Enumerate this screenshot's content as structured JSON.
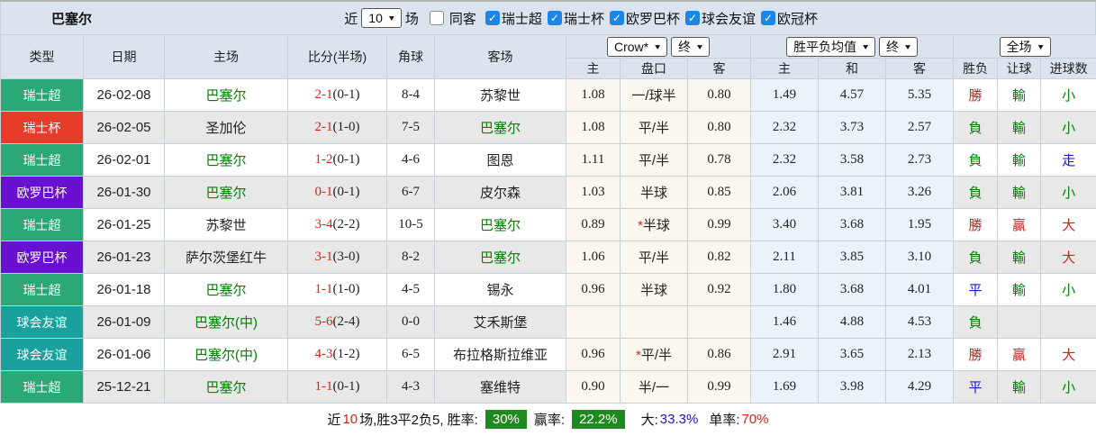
{
  "topbar": {
    "team": "巴塞尔",
    "recent_label": "近",
    "recent_value": "10",
    "matches_label": "场",
    "same_away": {
      "label": "同客",
      "checked": false
    },
    "league_filters": [
      {
        "label": "瑞士超",
        "checked": true
      },
      {
        "label": "瑞士杯",
        "checked": true
      },
      {
        "label": "欧罗巴杯",
        "checked": true
      },
      {
        "label": "球会友谊",
        "checked": true
      },
      {
        "label": "欧冠杯",
        "checked": true
      }
    ]
  },
  "controls": {
    "company": "Crow*",
    "company_time": "终",
    "europe": "胜平负均值",
    "europe_time": "终",
    "scope": "全场"
  },
  "columns": {
    "type": "类型",
    "date": "日期",
    "home": "主场",
    "score": "比分(半场)",
    "corner": "角球",
    "away": "客场",
    "ah_home": "主",
    "ah_line": "盘口",
    "ah_away": "客",
    "eu_home": "主",
    "eu_draw": "和",
    "eu_away": "客",
    "result": "胜负",
    "let_result": "让球",
    "goals": "进球数"
  },
  "colors": {
    "badge_green": "#2aa876",
    "badge_red": "#e83b28",
    "badge_purple": "#6a10d0",
    "badge_teal": "#19a29d",
    "text_green": "#008000",
    "text_red": "#d42318",
    "text_blue": "#1515cc",
    "bg_handicap": "#fbf6ee",
    "bg_europe": "#eaf2fa",
    "bg_header": "#dbe4ee",
    "bg_stripe": "#e8e8e8",
    "checkbox_blue": "#1b86e8",
    "footer_badge_green": "#1e8a1e"
  },
  "rows": [
    {
      "type": "瑞士超",
      "badge": "green",
      "date": "26-02-08",
      "home": "巴塞尔",
      "home_self": true,
      "score": "2-1",
      "half": "(0-1)",
      "corner": "8-4",
      "away": "苏黎世",
      "away_self": false,
      "ah_home": "1.08",
      "ah_star": "",
      "ah_line": "一/球半",
      "ah_away": "0.80",
      "eu_home": "1.49",
      "eu_draw": "4.57",
      "eu_away": "5.35",
      "result": "勝",
      "result_color": "darkred",
      "let": "輸",
      "let_color": "green",
      "goal": "小",
      "goal_color": "green"
    },
    {
      "type": "瑞士杯",
      "badge": "red",
      "date": "26-02-05",
      "home": "圣加伦",
      "home_self": false,
      "score": "2-1",
      "half": "(1-0)",
      "corner": "7-5",
      "away": "巴塞尔",
      "away_self": true,
      "ah_home": "1.08",
      "ah_star": "",
      "ah_line": "平/半",
      "ah_away": "0.80",
      "eu_home": "2.32",
      "eu_draw": "3.73",
      "eu_away": "2.57",
      "result": "負",
      "result_color": "green",
      "let": "輸",
      "let_color": "green",
      "goal": "小",
      "goal_color": "green"
    },
    {
      "type": "瑞士超",
      "badge": "green",
      "date": "26-02-01",
      "home": "巴塞尔",
      "home_self": true,
      "score": "1-2",
      "half": "(0-1)",
      "corner": "4-6",
      "away": "图恩",
      "away_self": false,
      "ah_home": "1.11",
      "ah_star": "",
      "ah_line": "平/半",
      "ah_away": "0.78",
      "eu_home": "2.32",
      "eu_draw": "3.58",
      "eu_away": "2.73",
      "result": "負",
      "result_color": "green",
      "let": "輸",
      "let_color": "green",
      "goal": "走",
      "goal_color": "blue"
    },
    {
      "type": "欧罗巴杯",
      "badge": "purple",
      "date": "26-01-30",
      "home": "巴塞尔",
      "home_self": true,
      "score": "0-1",
      "half": "(0-1)",
      "corner": "6-7",
      "away": "皮尔森",
      "away_self": false,
      "ah_home": "1.03",
      "ah_star": "",
      "ah_line": "半球",
      "ah_away": "0.85",
      "eu_home": "2.06",
      "eu_draw": "3.81",
      "eu_away": "3.26",
      "result": "負",
      "result_color": "green",
      "let": "輸",
      "let_color": "green",
      "goal": "小",
      "goal_color": "green"
    },
    {
      "type": "瑞士超",
      "badge": "green",
      "date": "26-01-25",
      "home": "苏黎世",
      "home_self": false,
      "score": "3-4",
      "half": "(2-2)",
      "corner": "10-5",
      "away": "巴塞尔",
      "away_self": true,
      "ah_home": "0.89",
      "ah_star": "*",
      "ah_line": "半球",
      "ah_away": "0.99",
      "eu_home": "3.40",
      "eu_draw": "3.68",
      "eu_away": "1.95",
      "result": "勝",
      "result_color": "darkred",
      "let": "贏",
      "let_color": "darkred",
      "goal": "大",
      "goal_color": "red"
    },
    {
      "type": "欧罗巴杯",
      "badge": "purple",
      "date": "26-01-23",
      "home": "萨尔茨堡红牛",
      "home_self": false,
      "score": "3-1",
      "half": "(3-0)",
      "corner": "8-2",
      "away": "巴塞尔",
      "away_self": true,
      "ah_home": "1.06",
      "ah_star": "",
      "ah_line": "平/半",
      "ah_away": "0.82",
      "eu_home": "2.11",
      "eu_draw": "3.85",
      "eu_away": "3.10",
      "result": "負",
      "result_color": "green",
      "let": "輸",
      "let_color": "green",
      "goal": "大",
      "goal_color": "red"
    },
    {
      "type": "瑞士超",
      "badge": "green",
      "date": "26-01-18",
      "home": "巴塞尔",
      "home_self": true,
      "score": "1-1",
      "half": "(1-0)",
      "corner": "4-5",
      "away": "锡永",
      "away_self": false,
      "ah_home": "0.96",
      "ah_star": "",
      "ah_line": "半球",
      "ah_away": "0.92",
      "eu_home": "1.80",
      "eu_draw": "3.68",
      "eu_away": "4.01",
      "result": "平",
      "result_color": "blue",
      "let": "輸",
      "let_color": "green",
      "goal": "小",
      "goal_color": "green"
    },
    {
      "type": "球会友谊",
      "badge": "teal",
      "date": "26-01-09",
      "home": "巴塞尔(中)",
      "home_self": true,
      "score": "5-6",
      "half": "(2-4)",
      "corner": "0-0",
      "away": "艾禾斯堡",
      "away_self": false,
      "ah_home": "",
      "ah_star": "",
      "ah_line": "",
      "ah_away": "",
      "eu_home": "1.46",
      "eu_draw": "4.88",
      "eu_away": "4.53",
      "result": "負",
      "result_color": "green",
      "let": "",
      "let_color": "",
      "goal": "",
      "goal_color": ""
    },
    {
      "type": "球会友谊",
      "badge": "teal",
      "date": "26-01-06",
      "home": "巴塞尔(中)",
      "home_self": true,
      "score": "4-3",
      "half": "(1-2)",
      "corner": "6-5",
      "away": "布拉格斯拉维亚",
      "away_self": false,
      "ah_home": "0.96",
      "ah_star": "*",
      "ah_line": "平/半",
      "ah_away": "0.86",
      "eu_home": "2.91",
      "eu_draw": "3.65",
      "eu_away": "2.13",
      "result": "勝",
      "result_color": "darkred",
      "let": "贏",
      "let_color": "darkred",
      "goal": "大",
      "goal_color": "red"
    },
    {
      "type": "瑞士超",
      "badge": "green",
      "date": "25-12-21",
      "home": "巴塞尔",
      "home_self": true,
      "score": "1-1",
      "half": "(0-1)",
      "corner": "4-3",
      "away": "塞维特",
      "away_self": false,
      "ah_home": "0.90",
      "ah_star": "",
      "ah_line": "半/一",
      "ah_away": "0.99",
      "eu_home": "1.69",
      "eu_draw": "3.98",
      "eu_away": "4.29",
      "result": "平",
      "result_color": "blue",
      "let": "輸",
      "let_color": "green",
      "goal": "小",
      "goal_color": "green"
    }
  ],
  "footer": {
    "prefix": "近",
    "count": "10",
    "mid": "场,胜3平2负5, 胜率:",
    "win_rate": "30%",
    "yield_label": "赢率:",
    "yield_rate": "22.2%",
    "big_label": "大:",
    "big_rate": "33.3%",
    "single_label": "单率:",
    "single_rate": "70%"
  }
}
